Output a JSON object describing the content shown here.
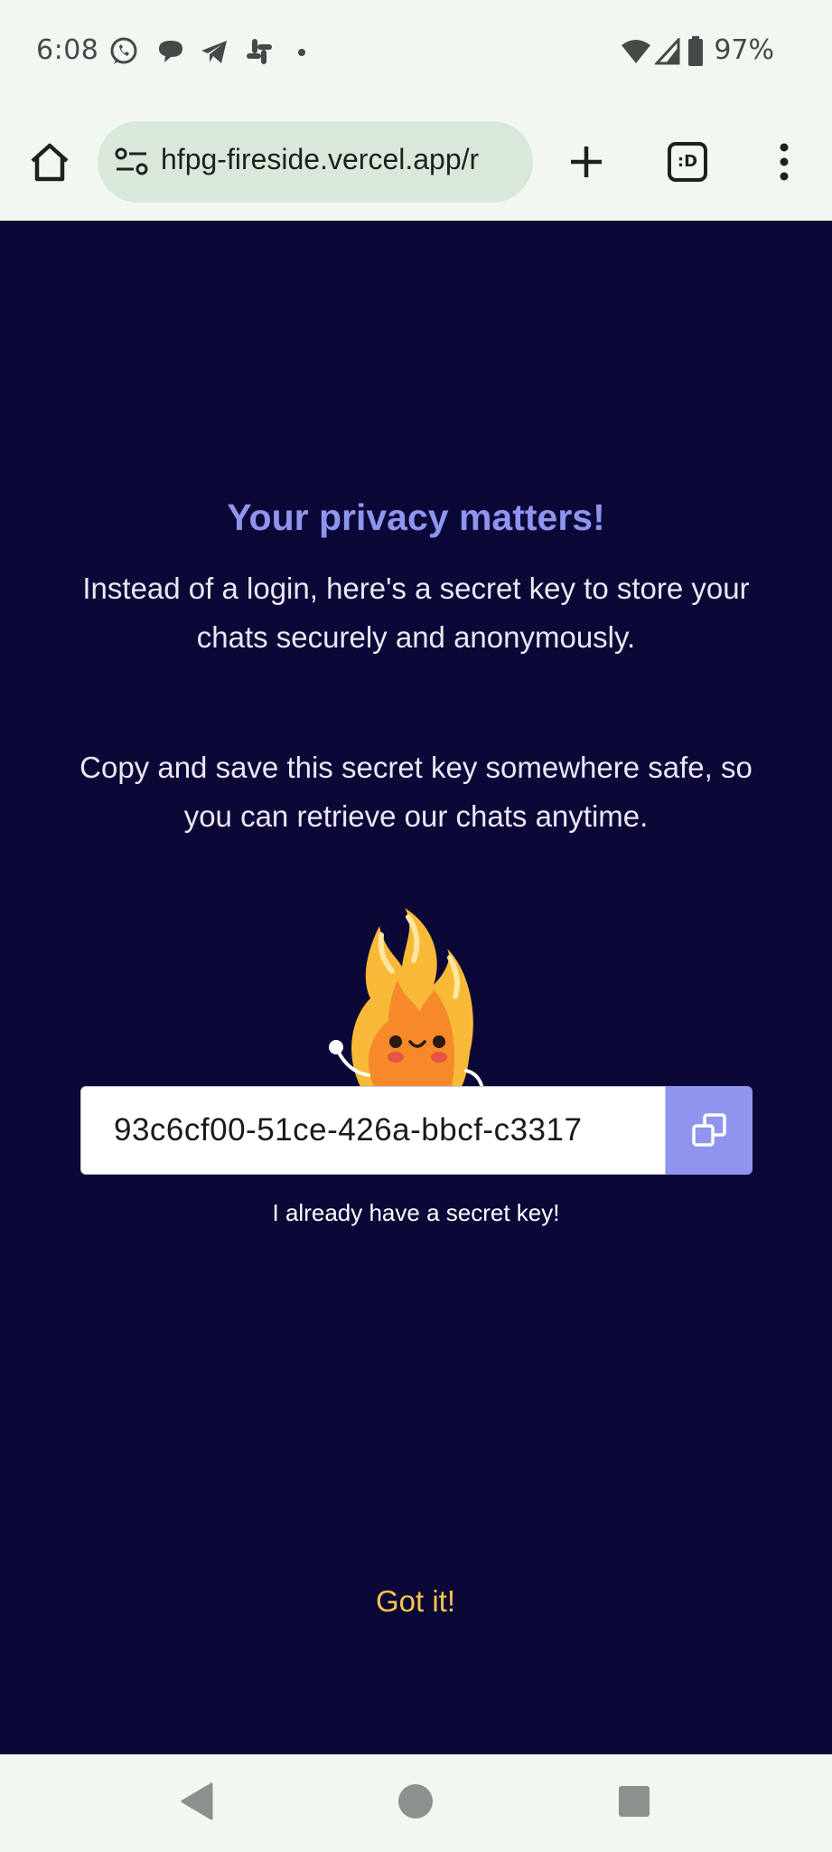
{
  "status_bar": {
    "time": "6:08",
    "battery_percent": "97%",
    "notification_icons": [
      "whatsapp-icon",
      "chat-bubble-icon",
      "telegram-icon",
      "slack-icon",
      "more-dot-icon"
    ],
    "system_icons": [
      "wifi-icon",
      "cell-signal-icon",
      "battery-icon"
    ]
  },
  "browser": {
    "url": "hfpg-fireside.vercel.app/r",
    "tab_switcher_label": ":D"
  },
  "content": {
    "title": "Your privacy matters!",
    "paragraph_1": "Instead of a login, here's a secret key to store your chats securely and anonymously.",
    "paragraph_2": "Copy and save this secret key somewhere safe, so you can retrieve our chats anytime.",
    "secret_key": "93c6cf00-51ce-426a-bbcf-c3317",
    "have_key_link": "I already have a secret key!",
    "confirm_button": "Got it!"
  },
  "colors": {
    "background": "#0b0737",
    "accent": "#8f95ee",
    "button_text": "#f8c44b",
    "chrome": "#f1f8f1"
  }
}
